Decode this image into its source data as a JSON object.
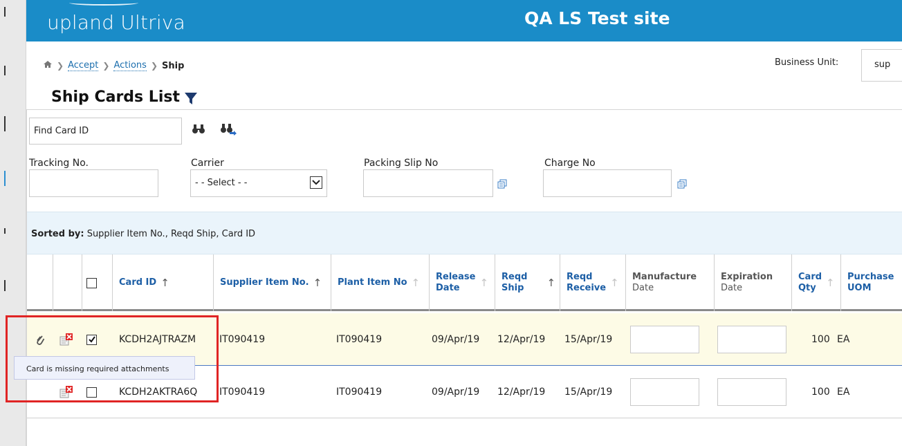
{
  "header": {
    "logo_brand": "upland",
    "logo_product": "Ultriva",
    "site_title": "QA LS Test site"
  },
  "breadcrumb": {
    "items": [
      "Accept",
      "Actions"
    ],
    "current": "Ship"
  },
  "business_unit": {
    "label": "Business Unit:",
    "value": "sup"
  },
  "page": {
    "title": "Ship Cards List"
  },
  "find": {
    "placeholder": "Find Card ID"
  },
  "filters": {
    "tracking_label": "Tracking No.",
    "carrier_label": "Carrier",
    "carrier_selected": "- - Select - -",
    "packing_label": "Packing Slip No",
    "charge_label": "Charge No"
  },
  "sorted": {
    "label": "Sorted by:",
    "value": "Supplier Item No., Reqd Ship, Card ID"
  },
  "columns": {
    "card_id": "Card ID",
    "supplier_item": "Supplier Item No.",
    "plant_item": "Plant Item No",
    "release_date_1": "Release",
    "release_date_2": "Date",
    "reqd_ship_1": "Reqd",
    "reqd_ship_2": "Ship",
    "reqd_receive_1": "Reqd",
    "reqd_receive_2": "Receive",
    "manufacture_1": "Manufacture",
    "manufacture_2": "Date",
    "expiration_1": "Expiration",
    "expiration_2": "Date",
    "card_qty_1": "Card",
    "card_qty_2": "Qty",
    "purchase_uom_1": "Purchase",
    "purchase_uom_2": "UOM",
    "sort_arrow": "↑"
  },
  "rows": [
    {
      "card_id": "KCDH2AJTRAZM",
      "supplier_item": "IT090419",
      "plant_item": "IT090419",
      "release_date": "09/Apr/19",
      "reqd_ship": "12/Apr/19",
      "reqd_receive": "15/Apr/19",
      "card_qty": "100",
      "uom": "EA",
      "checked": true
    },
    {
      "card_id": "KCDH2AKTRA6Q",
      "supplier_item": "IT090419",
      "plant_item": "IT090419",
      "release_date": "09/Apr/19",
      "reqd_ship": "12/Apr/19",
      "reqd_receive": "15/Apr/19",
      "card_qty": "100",
      "uom": "EA",
      "checked": false
    }
  ],
  "tooltip": {
    "text": "Card is missing required attachments"
  },
  "icons": {
    "home": "home-icon",
    "filter": "filter-icon",
    "find": "binoculars-icon",
    "find_next": "binoculars-next-icon",
    "copy": "copy-icon",
    "attachment": "paperclip-icon",
    "missing_attachment": "missing-attachment-icon"
  },
  "colors": {
    "header_bg": "#1a8cc8",
    "link": "#1d6fae",
    "highlight_box": "#e02424",
    "selected_row_bg": "#fdfbe6"
  }
}
